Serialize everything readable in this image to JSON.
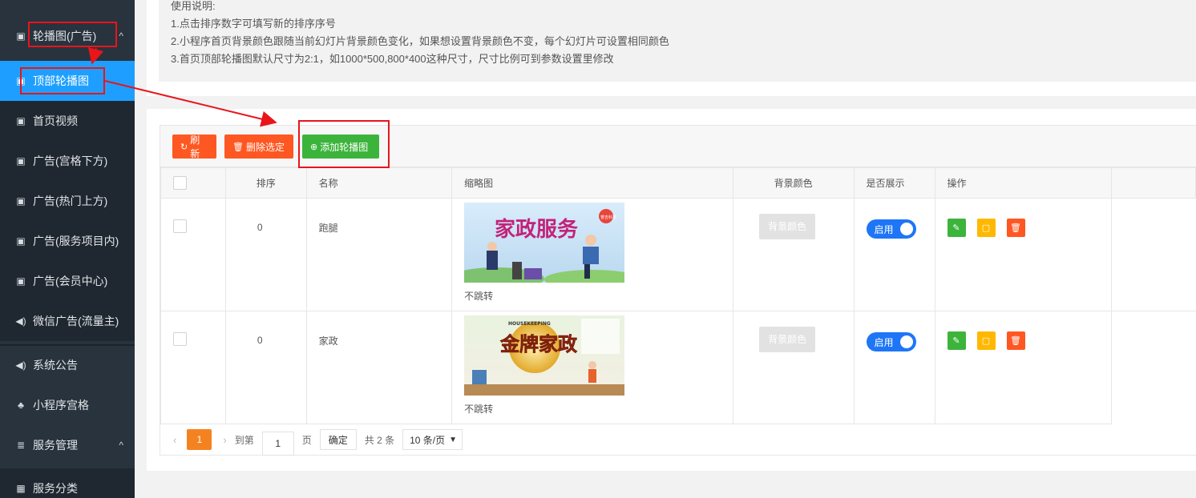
{
  "sidebar": {
    "items": [
      {
        "label": "轮播图(广告)",
        "icon": "image-icon",
        "caret": "^"
      },
      {
        "label": "顶部轮播图",
        "icon": "image-icon"
      },
      {
        "label": "首页视频",
        "icon": "image-icon"
      },
      {
        "label": "广告(宫格下方)",
        "icon": "image-icon"
      },
      {
        "label": "广告(热门上方)",
        "icon": "image-icon"
      },
      {
        "label": "广告(服务项目内)",
        "icon": "image-icon"
      },
      {
        "label": "广告(会员中心)",
        "icon": "image-icon"
      },
      {
        "label": "微信广告(流量主)",
        "icon": "speaker-icon"
      },
      {
        "label": "系统公告",
        "icon": "speaker-icon"
      },
      {
        "label": "小程序宫格",
        "icon": "sitemap-icon"
      },
      {
        "label": "服务管理",
        "icon": "server-icon",
        "caret": "^"
      },
      {
        "label": "服务分类",
        "icon": "grid-icon"
      }
    ]
  },
  "instructions": {
    "title": "使用说明:",
    "lines": [
      "1.点击排序数字可填写新的排序序号",
      "2.小程序首页背景颜色跟随当前幻灯片背景颜色变化，如果想设置背景颜色不变，每个幻灯片可设置相同颜色",
      "3.首页顶部轮播图默认尺寸为2:1，如1000*500,800*400这种尺寸，尺寸比例可到参数设置里修改"
    ]
  },
  "toolbar": {
    "refresh": "刷新",
    "delete_selected": "删除选定",
    "add": "添加轮播图"
  },
  "table": {
    "headers": [
      "排序",
      "名称",
      "缩略图",
      "背景颜色",
      "是否展示",
      "操作"
    ],
    "rows": [
      {
        "order": "0",
        "name": "跑腿",
        "jump": "不跳转",
        "bg_label": "背景颜色",
        "show": "启用",
        "thumb_title": "家政服务",
        "thumb_tag": "誉吉科技"
      },
      {
        "order": "0",
        "name": "家政",
        "jump": "不跳转",
        "bg_label": "背景颜色",
        "show": "启用",
        "thumb_title": "金牌家政",
        "thumb_tag": "HOUSEKEEPING"
      }
    ]
  },
  "pager": {
    "current": "1",
    "goto": "到第",
    "page_value": "1",
    "page_unit": "页",
    "confirm": "确定",
    "total": "共 2 条",
    "size": "10 条/页"
  },
  "colors": {
    "sidebar_bg": "#28333e",
    "active": "#1e9fff",
    "orange": "#ff5722",
    "green": "#3cb43c",
    "annotation": "#e8151b"
  }
}
